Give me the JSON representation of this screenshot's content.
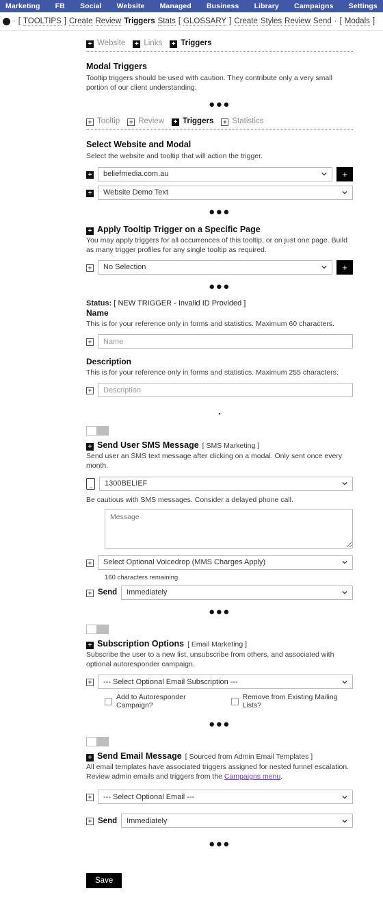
{
  "topnav": {
    "items": [
      "Marketing",
      "FB",
      "Social",
      "Website",
      "Managed",
      "Business",
      "Library",
      "Campaigns",
      "Settings"
    ],
    "bg": "#4158a6"
  },
  "subnav": {
    "bracket_open": "[",
    "tooltips_label": "TOOLTIPS",
    "bracket_close": "]",
    "sep": "·",
    "items": [
      {
        "label": "Create",
        "active": false
      },
      {
        "label": "Review",
        "active": false
      },
      {
        "label": "Triggers",
        "active": true
      },
      {
        "label": "Stats",
        "active": false
      }
    ],
    "glossary_label": "GLOSSARY",
    "items2": [
      {
        "label": "Create",
        "active": false
      },
      {
        "label": "Styles",
        "active": false
      },
      {
        "label": "Review",
        "active": false
      },
      {
        "label": "Send",
        "active": false
      }
    ],
    "modals_label": "Modals"
  },
  "chips_top": [
    {
      "label": "Website",
      "active": false,
      "icon": "plus-square-solid-icon"
    },
    {
      "label": "Links",
      "active": false,
      "icon": "plus-square-solid-icon"
    },
    {
      "label": "Triggers",
      "active": true,
      "icon": "plus-square-solid-icon"
    }
  ],
  "modal_triggers": {
    "title": "Modal Triggers",
    "description": "Tooltip triggers should be used with caution. They contribute only a very small portion of our client understanding."
  },
  "chips_second": [
    {
      "label": "Tooltip",
      "active": false
    },
    {
      "label": "Review",
      "active": false
    },
    {
      "label": "Triggers",
      "active": true
    },
    {
      "label": "Statistics",
      "active": false
    }
  ],
  "select_website": {
    "title": "Select Website and Modal",
    "description": "Select the website and tooltip that will action the trigger.",
    "website_value": "beliefmedia.com.au",
    "modal_value": "Website Demo Text",
    "add_button": "+"
  },
  "specific_page": {
    "title": "Apply Tooltip Trigger on a Specific Page",
    "description": "You may apply triggers for all occurrences of this tooltip, or on just one page. Build as many trigger profiles for any single tooltip as required.",
    "value": "No Selection",
    "add_button": "+"
  },
  "status": {
    "label": "Status:",
    "value": "[ NEW TRIGGER - Invalid ID Provided ]"
  },
  "name_field": {
    "title": "Name",
    "description": "This is for your reference only in forms and statistics. Maximum 60 characters.",
    "placeholder": "Name",
    "value": ""
  },
  "description_field": {
    "title": "Description",
    "description": "This is for your reference only in forms and statistics. Maximum 255 characters.",
    "placeholder": "Description",
    "value": ""
  },
  "sms": {
    "toggle_state": "off",
    "title": "Send User SMS Message",
    "tag": "[ SMS Marketing ]",
    "description": "Send user an SMS text message after clicking on a modal. Only sent once every month.",
    "number_value": "1300BELIEF",
    "caution": "Be cautious with SMS messages. Consider a delayed phone call.",
    "message_placeholder": "Message",
    "message_value": "",
    "voicedrop_value": "Select Optional Voicedrop (MMS Charges Apply)",
    "chars_remaining": "160 characters remaining",
    "send_label": "Send",
    "send_value": "Immediately"
  },
  "subscription": {
    "toggle_state": "off",
    "title": "Subscription Options",
    "tag": "[ Email Marketing ]",
    "description": "Subscribe the user to a new list, unsubscribe from others, and associated with optional autoresponder campaign.",
    "select_value": "--- Select Optional Email Subscription ---",
    "checkbox1": "Add to Autoresponder Campaign?",
    "checkbox2": "Remove from Existing Mailing Lists?",
    "checkbox1_checked": false,
    "checkbox2_checked": false
  },
  "email": {
    "toggle_state": "off",
    "title": "Send Email Message",
    "tag": "[ Sourced from Admin Email Templates ]",
    "description_pre": "All email templates have associated triggers assigned for nested funnel escalation. Review admin emails and triggers from the ",
    "description_link": "Campaigns menu",
    "description_post": ".",
    "select_value": "--- Select Optional Email ---",
    "send_label": "Send",
    "send_value": "Immediately"
  },
  "ellipsis": "●●●",
  "dot": "▪",
  "save": {
    "label": "Save"
  },
  "colors": {
    "navbar": "#4158a6",
    "accent_black": "#000000",
    "link_purple": "#6a3fa0",
    "toggle_off": "#bdbdbd"
  }
}
